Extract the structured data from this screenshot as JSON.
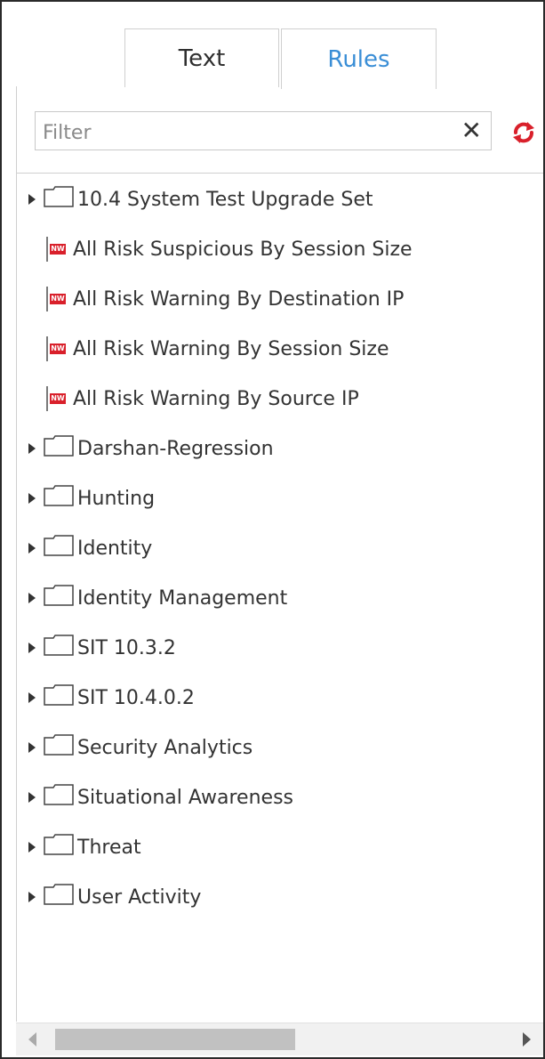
{
  "tabs": [
    {
      "label": "Text",
      "active": false
    },
    {
      "label": "Rules",
      "active": true
    }
  ],
  "filter": {
    "placeholder": "Filter",
    "value": "",
    "clear_icon": "close-icon",
    "refresh_icon": "refresh-icon"
  },
  "tree": {
    "items": [
      {
        "type": "folder",
        "label": "10.4 System Test Upgrade Set"
      },
      {
        "type": "rule",
        "label": "All Risk Suspicious By Session Size",
        "badge": "NW"
      },
      {
        "type": "rule",
        "label": "All Risk Warning By Destination IP",
        "badge": "NW"
      },
      {
        "type": "rule",
        "label": "All Risk Warning By Session Size",
        "badge": "NW"
      },
      {
        "type": "rule",
        "label": "All Risk Warning By Source IP",
        "badge": "NW"
      },
      {
        "type": "folder",
        "label": "Darshan-Regression"
      },
      {
        "type": "folder",
        "label": "Hunting"
      },
      {
        "type": "folder",
        "label": "Identity"
      },
      {
        "type": "folder",
        "label": "Identity Management"
      },
      {
        "type": "folder",
        "label": "SIT 10.3.2"
      },
      {
        "type": "folder",
        "label": "SIT 10.4.0.2"
      },
      {
        "type": "folder",
        "label": "Security Analytics"
      },
      {
        "type": "folder",
        "label": "Situational Awareness"
      },
      {
        "type": "folder",
        "label": "Threat"
      },
      {
        "type": "folder",
        "label": "User Activity"
      }
    ]
  },
  "colors": {
    "active_tab": "#3a8ed6",
    "rule_badge": "#d9202b",
    "refresh": "#d9202b"
  }
}
